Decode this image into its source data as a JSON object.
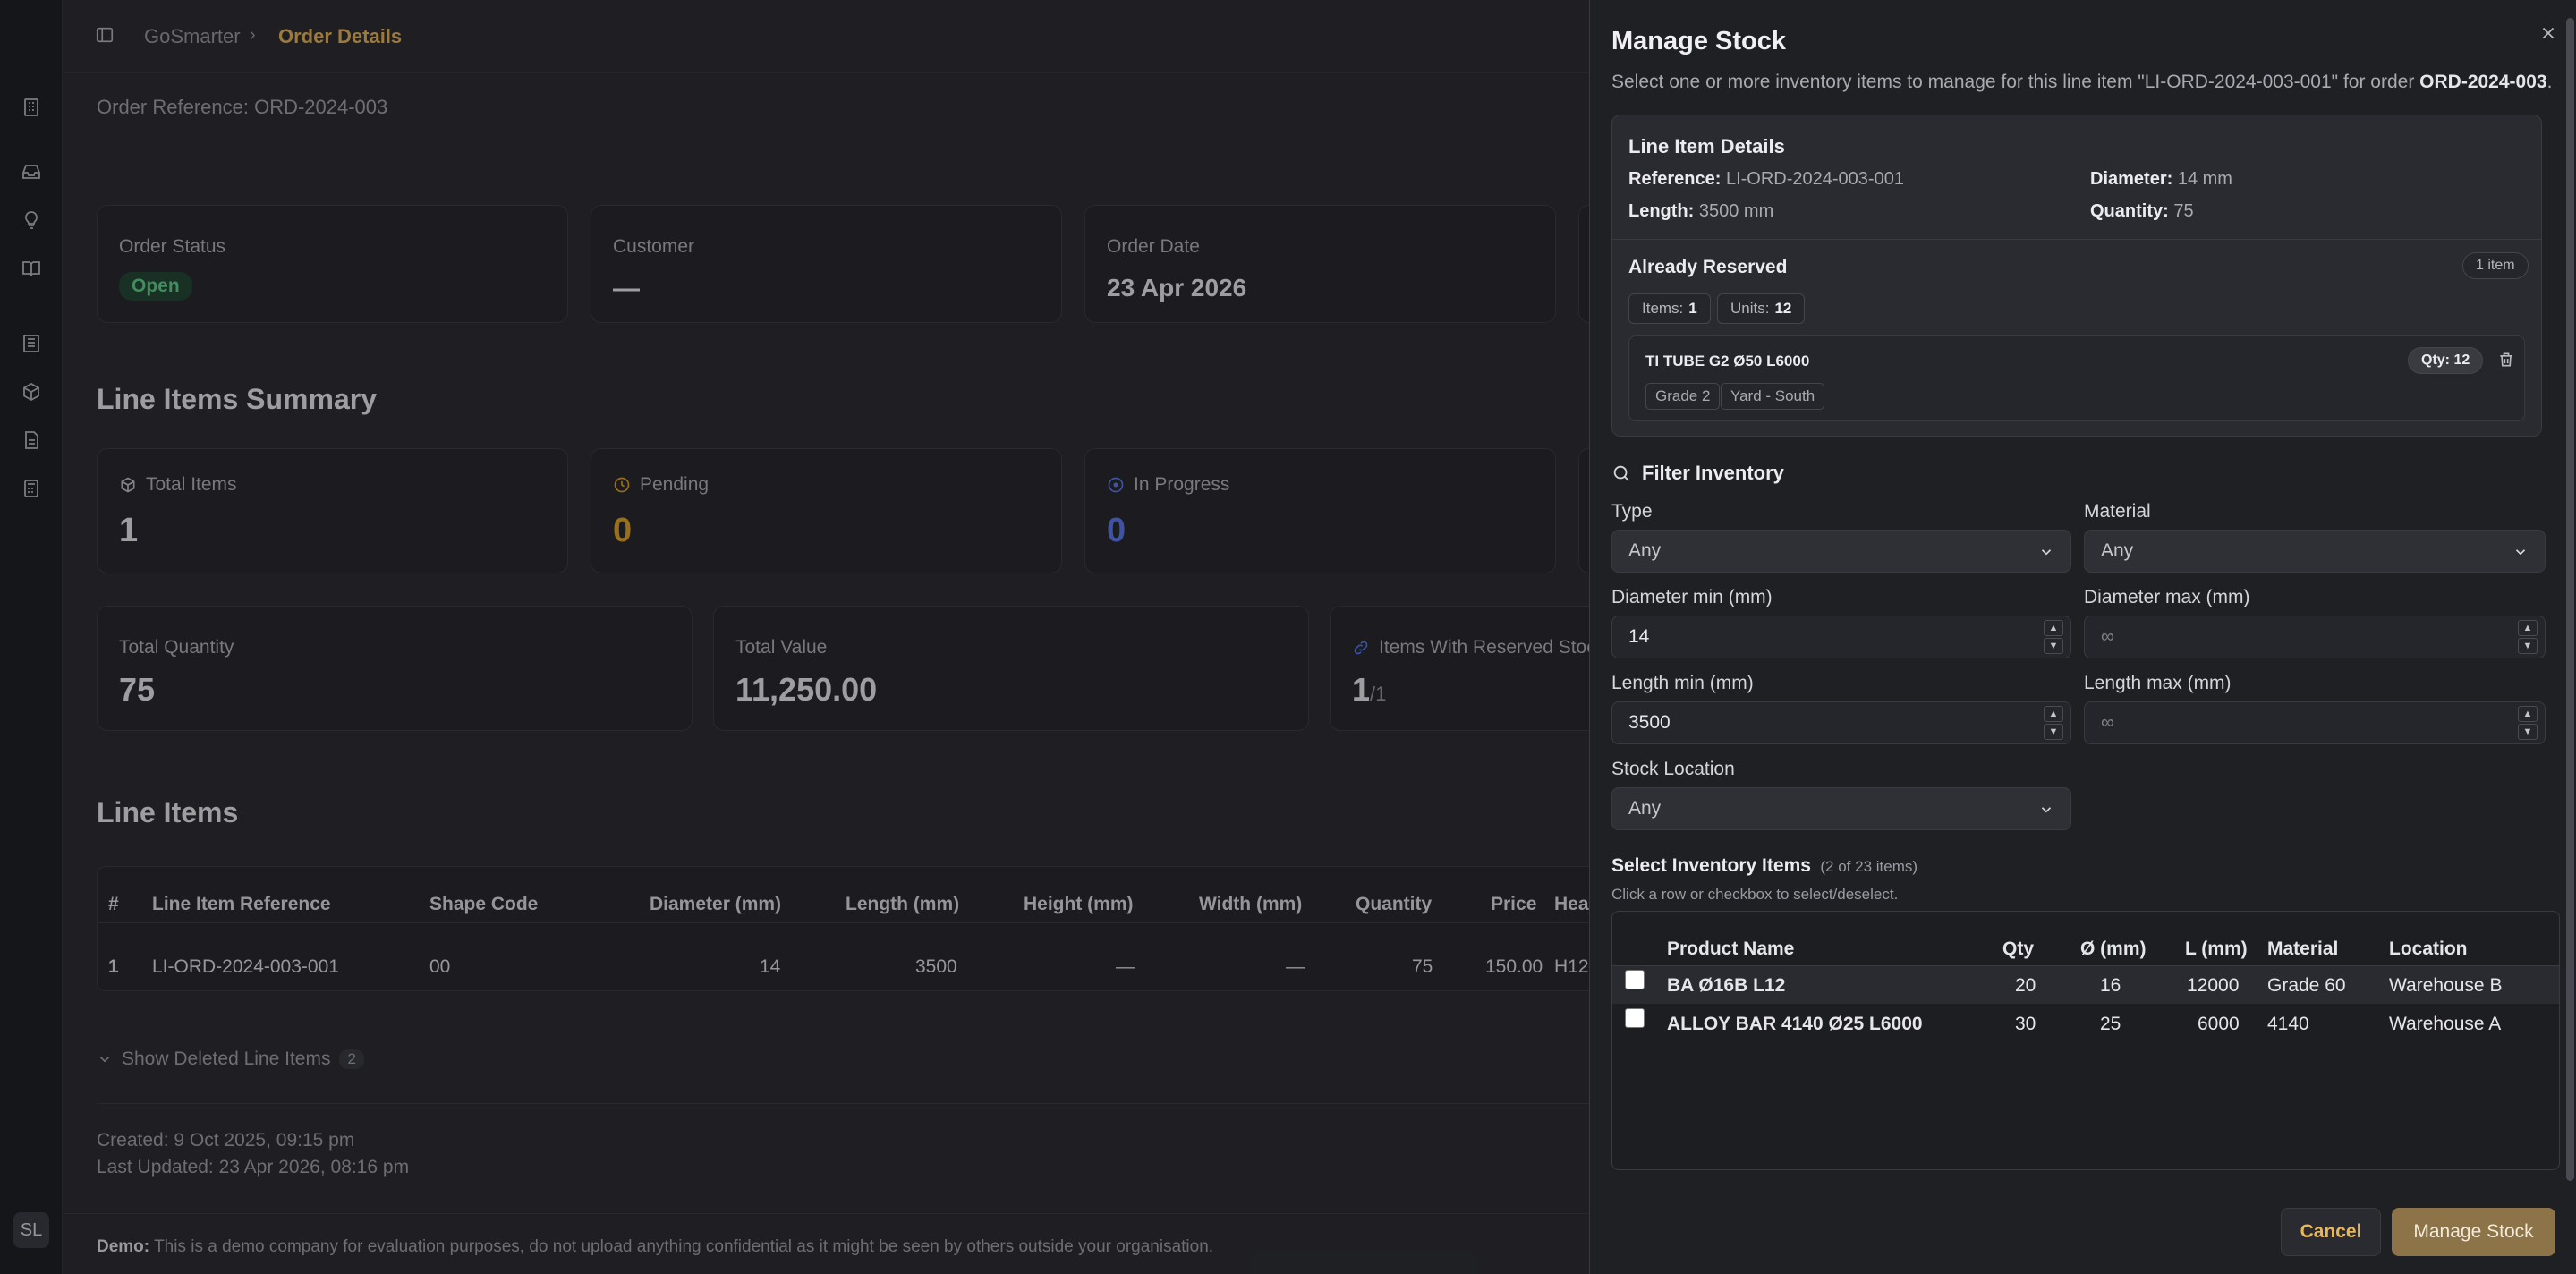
{
  "breadcrumb": {
    "root": "GoSmarter",
    "current": "Order Details"
  },
  "order": {
    "reference_line": "Order Reference: ORD-2024-003",
    "status_label": "Order Status",
    "status": "Open",
    "customer_label": "Customer",
    "customer": "—",
    "date_label": "Order Date",
    "date": "23 Apr 2026"
  },
  "summary": {
    "title": "Line Items Summary",
    "total_items_label": "Total Items",
    "total_items": "1",
    "pending_label": "Pending",
    "pending": "0",
    "in_progress_label": "In Progress",
    "in_progress": "0",
    "total_quantity_label": "Total Quantity",
    "total_quantity": "75",
    "total_value_label": "Total Value",
    "total_value": "11,250.00",
    "reserved_label": "Items With Reserved Stoc",
    "reserved": "1",
    "reserved_of": "/1"
  },
  "line_items": {
    "title": "Line Items",
    "headers": [
      "#",
      "Line Item Reference",
      "Shape Code",
      "Diameter (mm)",
      "Length (mm)",
      "Height (mm)",
      "Width (mm)",
      "Quantity",
      "Price",
      "Hea"
    ],
    "row": [
      "1",
      "LI-ORD-2024-003-001",
      "00",
      "14",
      "3500",
      "—",
      "—",
      "75",
      "150.00",
      "H12"
    ],
    "show_deleted": "Show Deleted Line Items",
    "deleted_count": "2",
    "created": "Created: 9 Oct 2025, 09:15 pm",
    "updated": "Last Updated: 23 Apr 2026, 08:16 pm"
  },
  "demo": {
    "label": "Demo:",
    "text": "This is a demo company for evaluation purposes, do not upload anything confidential as it might be seen by others outside your organisation."
  },
  "panel": {
    "title": "Manage Stock",
    "desc_prefix": "Select one or more inventory items to manage for this line item \"LI-ORD-2024-003-001\" for order ",
    "desc_order": "ORD-2024-003",
    "desc_suffix": ".",
    "details_title": "Line Item Details",
    "reference_key": "Reference:",
    "reference_val": "LI-ORD-2024-003-001",
    "diameter_key": "Diameter:",
    "diameter_val": "14 mm",
    "length_key": "Length:",
    "length_val": "3500 mm",
    "quantity_key": "Quantity:",
    "quantity_val": "75",
    "reserved_title": "Already Reserved",
    "reserved_count": "1 item",
    "items_key": "Items:",
    "items_val": "1",
    "units_key": "Units:",
    "units_val": "12",
    "reserved_item": {
      "name": "TI TUBE G2 Ø50 L6000",
      "qty": "Qty: 12",
      "grade": "Grade 2",
      "location": "Yard - South"
    },
    "filter_title": "Filter Inventory",
    "type_label": "Type",
    "type_value": "Any",
    "material_label": "Material",
    "material_value": "Any",
    "dmin_label": "Diameter min (mm)",
    "dmin_value": "14",
    "dmax_label": "Diameter max (mm)",
    "dmax_placeholder": "∞",
    "lmin_label": "Length min (mm)",
    "lmin_value": "3500",
    "lmax_label": "Length max (mm)",
    "lmax_placeholder": "∞",
    "location_label": "Stock Location",
    "location_value": "Any",
    "select_title": "Select Inventory Items",
    "select_count": "(2 of 23 items)",
    "select_hint": "Click a row or checkbox to select/deselect.",
    "inv_headers": [
      "Product Name",
      "Qty",
      "Ø (mm)",
      "L (mm)",
      "Material",
      "Location"
    ],
    "inv_rows": [
      [
        "BA Ø16B L12",
        "20",
        "16",
        "12000",
        "Grade 60",
        "Warehouse B"
      ],
      [
        "ALLOY BAR 4140 Ø25 L6000",
        "30",
        "25",
        "6000",
        "4140",
        "Warehouse A"
      ]
    ],
    "cancel": "Cancel",
    "manage": "Manage Stock"
  },
  "user": {
    "initials": "SL"
  },
  "colors": {
    "accent": "#e8b75a",
    "pending": "#e5a623",
    "progress": "#5b7cf5",
    "open": "#5fd48a"
  }
}
